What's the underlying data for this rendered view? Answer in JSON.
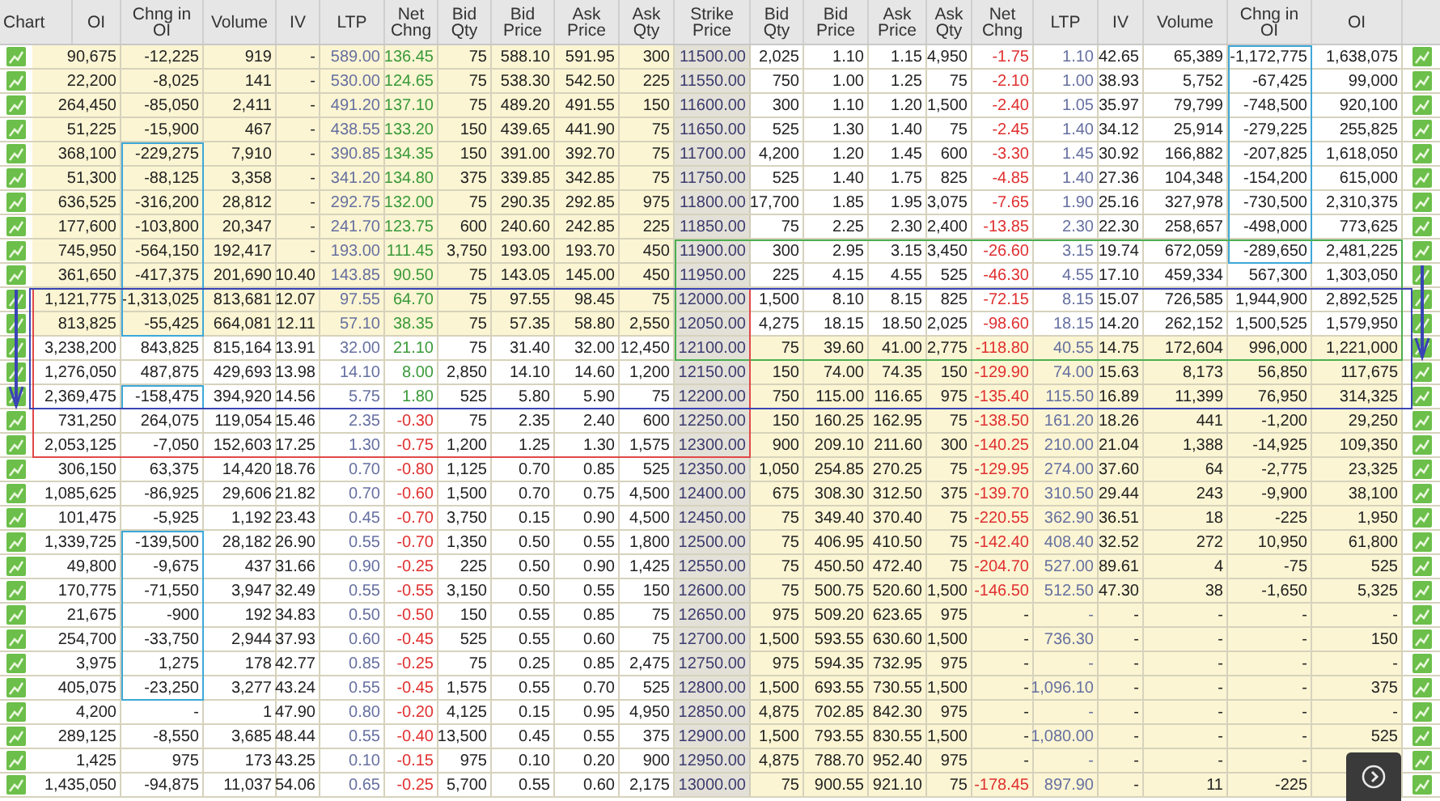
{
  "columns": [
    "Chart",
    "OI",
    "Chng in OI",
    "Volume",
    "IV",
    "LTP",
    "Net Chng",
    "Bid Qty",
    "Bid Price",
    "Ask Price",
    "Ask Qty",
    "Strike Price",
    "Bid Qty",
    "Bid Price",
    "Ask Price",
    "Ask Qty",
    "Net Chng",
    "LTP",
    "IV",
    "Volume",
    "Chng in OI",
    "OI"
  ],
  "rows": [
    {
      "strike": "11500.00",
      "call_itm": true,
      "put_itm": false,
      "call": [
        "90,675",
        "-12,225",
        "919",
        "-",
        "589.00",
        {
          "text": "136.45",
          "color": "#3a9a3a"
        },
        "75",
        "588.10",
        "591.95",
        "300"
      ],
      "put": [
        "2,025",
        "1.10",
        "1.15",
        "4,950",
        {
          "text": "-1.75",
          "color": "#e03030"
        },
        "1.10",
        "42.65",
        "65,389",
        "-1,172,775",
        "1,638,075"
      ]
    },
    {
      "strike": "11550.00",
      "call_itm": true,
      "put_itm": false,
      "call": [
        "22,200",
        "-8,025",
        "141",
        "-",
        "530.00",
        {
          "text": "124.65",
          "color": "#3a9a3a"
        },
        "75",
        "538.30",
        "542.50",
        "225"
      ],
      "put": [
        "750",
        "1.00",
        "1.25",
        "75",
        {
          "text": "-2.10",
          "color": "#e03030"
        },
        "1.00",
        "38.93",
        "5,752",
        "-67,425",
        "99,000"
      ]
    },
    {
      "strike": "11600.00",
      "call_itm": true,
      "put_itm": false,
      "call": [
        "264,450",
        "-85,050",
        "2,411",
        "-",
        "491.20",
        {
          "text": "137.10",
          "color": "#3a9a3a"
        },
        "75",
        "489.20",
        "491.55",
        "150"
      ],
      "put": [
        "300",
        "1.10",
        "1.20",
        "1,500",
        {
          "text": "-2.40",
          "color": "#e03030"
        },
        "1.05",
        "35.97",
        "79,799",
        "-748,500",
        "920,100"
      ]
    },
    {
      "strike": "11650.00",
      "call_itm": true,
      "put_itm": false,
      "call": [
        "51,225",
        "-15,900",
        "467",
        "-",
        "438.55",
        {
          "text": "133.20",
          "color": "#3a9a3a"
        },
        "150",
        "439.65",
        "441.90",
        "75"
      ],
      "put": [
        "525",
        "1.30",
        "1.40",
        "75",
        {
          "text": "-2.45",
          "color": "#e03030"
        },
        "1.40",
        "34.12",
        "25,914",
        "-279,225",
        "255,825"
      ]
    },
    {
      "strike": "11700.00",
      "call_itm": true,
      "put_itm": false,
      "call": [
        "368,100",
        "-229,275",
        "7,910",
        "-",
        "390.85",
        {
          "text": "134.35",
          "color": "#3a9a3a"
        },
        "150",
        "391.00",
        "392.70",
        "75"
      ],
      "put": [
        "4,200",
        "1.20",
        "1.45",
        "600",
        {
          "text": "-3.30",
          "color": "#e03030"
        },
        "1.45",
        "30.92",
        "166,882",
        "-207,825",
        "1,618,050"
      ]
    },
    {
      "strike": "11750.00",
      "call_itm": true,
      "put_itm": false,
      "call": [
        "51,300",
        "-88,125",
        "3,358",
        "-",
        "341.20",
        {
          "text": "134.80",
          "color": "#3a9a3a"
        },
        "375",
        "339.85",
        "342.85",
        "75"
      ],
      "put": [
        "525",
        "1.40",
        "1.75",
        "825",
        {
          "text": "-4.85",
          "color": "#e03030"
        },
        "1.40",
        "27.36",
        "104,348",
        "-154,200",
        "615,000"
      ]
    },
    {
      "strike": "11800.00",
      "call_itm": true,
      "put_itm": false,
      "call": [
        "636,525",
        "-316,200",
        "28,812",
        "-",
        "292.75",
        {
          "text": "132.00",
          "color": "#3a9a3a"
        },
        "75",
        "290.35",
        "292.85",
        "975"
      ],
      "put": [
        "17,700",
        "1.85",
        "1.95",
        "3,075",
        {
          "text": "-7.65",
          "color": "#e03030"
        },
        "1.90",
        "25.16",
        "327,978",
        "-730,500",
        "2,310,375"
      ]
    },
    {
      "strike": "11850.00",
      "call_itm": true,
      "put_itm": false,
      "call": [
        "177,600",
        "-103,800",
        "20,347",
        "-",
        "241.70",
        {
          "text": "123.75",
          "color": "#3a9a3a"
        },
        "600",
        "240.60",
        "242.85",
        "225"
      ],
      "put": [
        "75",
        "2.25",
        "2.30",
        "2,400",
        {
          "text": "-13.85",
          "color": "#e03030"
        },
        "2.30",
        "22.30",
        "258,657",
        "-498,000",
        "773,625"
      ]
    },
    {
      "strike": "11900.00",
      "call_itm": true,
      "put_itm": false,
      "call": [
        "745,950",
        "-564,150",
        "192,417",
        "-",
        "193.00",
        {
          "text": "111.45",
          "color": "#3a9a3a"
        },
        "3,750",
        "193.00",
        "193.70",
        "450"
      ],
      "put": [
        "300",
        "2.95",
        "3.15",
        "3,450",
        {
          "text": "-26.60",
          "color": "#e03030"
        },
        "3.15",
        "19.74",
        "672,059",
        "-289,650",
        "2,481,225"
      ]
    },
    {
      "strike": "11950.00",
      "call_itm": true,
      "put_itm": false,
      "call": [
        "361,650",
        "-417,375",
        "201,690",
        "10.40",
        "143.85",
        {
          "text": "90.50",
          "color": "#3a9a3a"
        },
        "75",
        "143.05",
        "145.00",
        "450"
      ],
      "put": [
        "225",
        "4.15",
        "4.55",
        "525",
        {
          "text": "-46.30",
          "color": "#e03030"
        },
        "4.55",
        "17.10",
        "459,334",
        "567,300",
        "1,303,050"
      ]
    },
    {
      "strike": "12000.00",
      "call_itm": true,
      "put_itm": false,
      "call": [
        "1,121,775",
        "-1,313,025",
        "813,681",
        "12.07",
        "97.55",
        {
          "text": "64.70",
          "color": "#3a9a3a"
        },
        "75",
        "97.55",
        "98.45",
        "75"
      ],
      "put": [
        "1,500",
        "8.10",
        "8.15",
        "825",
        {
          "text": "-72.15",
          "color": "#e03030"
        },
        "8.15",
        "15.07",
        "726,585",
        "1,944,900",
        "2,892,525"
      ]
    },
    {
      "strike": "12050.00",
      "call_itm": true,
      "put_itm": false,
      "call": [
        "813,825",
        "-55,425",
        "664,081",
        "12.11",
        "57.10",
        {
          "text": "38.35",
          "color": "#3a9a3a"
        },
        "75",
        "57.35",
        "58.80",
        "2,550"
      ],
      "put": [
        "4,275",
        "18.15",
        "18.50",
        "2,025",
        {
          "text": "-98.60",
          "color": "#e03030"
        },
        "18.15",
        "14.20",
        "262,152",
        "1,500,525",
        "1,579,950"
      ]
    },
    {
      "strike": "12100.00",
      "call_itm": false,
      "put_itm": true,
      "call": [
        "3,238,200",
        "843,825",
        "815,164",
        "13.91",
        "32.00",
        {
          "text": "21.10",
          "color": "#3a9a3a"
        },
        "75",
        "31.40",
        "32.00",
        "12,450"
      ],
      "put": [
        "75",
        "39.60",
        "41.00",
        "2,775",
        {
          "text": "-118.80",
          "color": "#e03030"
        },
        "40.55",
        "14.75",
        "172,604",
        "996,000",
        "1,221,000"
      ]
    },
    {
      "strike": "12150.00",
      "call_itm": false,
      "put_itm": true,
      "call": [
        "1,276,050",
        "487,875",
        "429,693",
        "13.98",
        "14.10",
        {
          "text": "8.00",
          "color": "#3a9a3a"
        },
        "2,850",
        "14.10",
        "14.60",
        "1,200"
      ],
      "put": [
        "150",
        "74.00",
        "74.35",
        "150",
        {
          "text": "-129.90",
          "color": "#e03030"
        },
        "74.00",
        "15.63",
        "8,173",
        "56,850",
        "117,675"
      ]
    },
    {
      "strike": "12200.00",
      "call_itm": false,
      "put_itm": true,
      "call": [
        "2,369,475",
        "-158,475",
        "394,920",
        "14.56",
        "5.75",
        {
          "text": "1.80",
          "color": "#3a9a3a"
        },
        "525",
        "5.80",
        "5.90",
        "75"
      ],
      "put": [
        "750",
        "115.00",
        "116.65",
        "975",
        {
          "text": "-135.40",
          "color": "#e03030"
        },
        "115.50",
        "16.89",
        "11,399",
        "76,950",
        "314,325"
      ]
    },
    {
      "strike": "12250.00",
      "call_itm": false,
      "put_itm": true,
      "call": [
        "731,250",
        "264,075",
        "119,054",
        "15.46",
        "2.35",
        {
          "text": "-0.30",
          "color": "#e03030"
        },
        "75",
        "2.35",
        "2.40",
        "600"
      ],
      "put": [
        "150",
        "160.25",
        "162.95",
        "75",
        {
          "text": "-138.50",
          "color": "#e03030"
        },
        "161.20",
        "18.26",
        "441",
        "-1,200",
        "29,250"
      ]
    },
    {
      "strike": "12300.00",
      "call_itm": false,
      "put_itm": true,
      "call": [
        "2,053,125",
        "-7,050",
        "152,603",
        "17.25",
        "1.30",
        {
          "text": "-0.75",
          "color": "#e03030"
        },
        "1,200",
        "1.25",
        "1.30",
        "1,575"
      ],
      "put": [
        "900",
        "209.10",
        "211.60",
        "300",
        {
          "text": "-140.25",
          "color": "#e03030"
        },
        "210.00",
        "21.04",
        "1,388",
        "-14,925",
        "109,350"
      ]
    },
    {
      "strike": "12350.00",
      "call_itm": false,
      "put_itm": true,
      "call": [
        "306,150",
        "63,375",
        "14,420",
        "18.76",
        "0.70",
        {
          "text": "-0.80",
          "color": "#e03030"
        },
        "1,125",
        "0.70",
        "0.85",
        "525"
      ],
      "put": [
        "1,050",
        "254.85",
        "270.25",
        "75",
        {
          "text": "-129.95",
          "color": "#e03030"
        },
        "274.00",
        "37.60",
        "64",
        "-2,775",
        "23,325"
      ]
    },
    {
      "strike": "12400.00",
      "call_itm": false,
      "put_itm": true,
      "call": [
        "1,085,625",
        "-86,925",
        "29,606",
        "21.82",
        "0.70",
        {
          "text": "-0.60",
          "color": "#e03030"
        },
        "1,500",
        "0.70",
        "0.75",
        "4,500"
      ],
      "put": [
        "675",
        "308.30",
        "312.50",
        "375",
        {
          "text": "-139.70",
          "color": "#e03030"
        },
        "310.50",
        "29.44",
        "243",
        "-9,900",
        "38,100"
      ]
    },
    {
      "strike": "12450.00",
      "call_itm": false,
      "put_itm": true,
      "call": [
        "101,475",
        "-5,925",
        "1,192",
        "23.43",
        "0.45",
        {
          "text": "-0.70",
          "color": "#e03030"
        },
        "3,750",
        "0.15",
        "0.90",
        "4,500"
      ],
      "put": [
        "75",
        "349.40",
        "370.40",
        "75",
        {
          "text": "-220.55",
          "color": "#e03030"
        },
        "362.90",
        "36.51",
        "18",
        "-225",
        "1,950"
      ]
    },
    {
      "strike": "12500.00",
      "call_itm": false,
      "put_itm": true,
      "call": [
        "1,339,725",
        "-139,500",
        "28,182",
        "26.90",
        "0.55",
        {
          "text": "-0.70",
          "color": "#e03030"
        },
        "1,350",
        "0.50",
        "0.55",
        "1,800"
      ],
      "put": [
        "75",
        "406.95",
        "410.50",
        "75",
        {
          "text": "-142.40",
          "color": "#e03030"
        },
        "408.40",
        "32.52",
        "272",
        "10,950",
        "61,800"
      ]
    },
    {
      "strike": "12550.00",
      "call_itm": false,
      "put_itm": true,
      "call": [
        "49,800",
        "-9,675",
        "437",
        "31.66",
        "0.90",
        {
          "text": "-0.25",
          "color": "#e03030"
        },
        "225",
        "0.50",
        "0.90",
        "1,425"
      ],
      "put": [
        "75",
        "450.50",
        "472.40",
        "75",
        {
          "text": "-204.70",
          "color": "#e03030"
        },
        "527.00",
        "89.61",
        "4",
        "-75",
        "525"
      ]
    },
    {
      "strike": "12600.00",
      "call_itm": false,
      "put_itm": true,
      "call": [
        "170,775",
        "-71,550",
        "3,947",
        "32.49",
        "0.55",
        {
          "text": "-0.55",
          "color": "#e03030"
        },
        "3,150",
        "0.50",
        "0.55",
        "150"
      ],
      "put": [
        "75",
        "500.75",
        "520.60",
        "1,500",
        {
          "text": "-146.50",
          "color": "#e03030"
        },
        "512.50",
        "47.30",
        "38",
        "-1,650",
        "5,325"
      ]
    },
    {
      "strike": "12650.00",
      "call_itm": false,
      "put_itm": true,
      "call": [
        "21,675",
        "-900",
        "192",
        "34.83",
        "0.50",
        {
          "text": "-0.50",
          "color": "#e03030"
        },
        "150",
        "0.55",
        "0.85",
        "75"
      ],
      "put": [
        "975",
        "509.20",
        "623.65",
        "975",
        "-",
        "-",
        "-",
        "-",
        "-",
        "-"
      ]
    },
    {
      "strike": "12700.00",
      "call_itm": false,
      "put_itm": true,
      "call": [
        "254,700",
        "-33,750",
        "2,944",
        "37.93",
        "0.60",
        {
          "text": "-0.45",
          "color": "#e03030"
        },
        "525",
        "0.55",
        "0.60",
        "75"
      ],
      "put": [
        "1,500",
        "593.55",
        "630.60",
        "1,500",
        "-",
        "736.30",
        "-",
        "-",
        "-",
        "150"
      ]
    },
    {
      "strike": "12750.00",
      "call_itm": false,
      "put_itm": true,
      "call": [
        "3,975",
        "1,275",
        "178",
        "42.77",
        "0.85",
        {
          "text": "-0.25",
          "color": "#e03030"
        },
        "75",
        "0.25",
        "0.85",
        "2,475"
      ],
      "put": [
        "975",
        "594.35",
        "732.95",
        "975",
        "-",
        "-",
        "-",
        "-",
        "-",
        "-"
      ]
    },
    {
      "strike": "12800.00",
      "call_itm": false,
      "put_itm": true,
      "call": [
        "405,075",
        "-23,250",
        "3,277",
        "43.24",
        "0.55",
        {
          "text": "-0.45",
          "color": "#e03030"
        },
        "1,575",
        "0.55",
        "0.70",
        "525"
      ],
      "put": [
        "1,500",
        "693.55",
        "730.55",
        "1,500",
        "-",
        "1,096.10",
        "-",
        "-",
        "-",
        "375"
      ]
    },
    {
      "strike": "12850.00",
      "call_itm": false,
      "put_itm": true,
      "call": [
        "4,200",
        "-",
        "1",
        "47.90",
        "0.80",
        {
          "text": "-0.20",
          "color": "#e03030"
        },
        "4,125",
        "0.15",
        "0.95",
        "4,950"
      ],
      "put": [
        "4,875",
        "702.85",
        "842.30",
        "975",
        "-",
        "-",
        "-",
        "-",
        "-",
        "-"
      ]
    },
    {
      "strike": "12900.00",
      "call_itm": false,
      "put_itm": true,
      "call": [
        "289,125",
        "-8,550",
        "3,685",
        "48.44",
        "0.55",
        {
          "text": "-0.40",
          "color": "#e03030"
        },
        "13,500",
        "0.45",
        "0.55",
        "375"
      ],
      "put": [
        "1,500",
        "793.55",
        "830.55",
        "1,500",
        "-",
        "1,080.00",
        "-",
        "-",
        "-",
        "525"
      ]
    },
    {
      "strike": "12950.00",
      "call_itm": false,
      "put_itm": true,
      "call": [
        "1,425",
        "975",
        "173",
        "43.25",
        "0.10",
        {
          "text": "-0.15",
          "color": "#e03030"
        },
        "975",
        "0.10",
        "0.20",
        "900"
      ],
      "put": [
        "4,875",
        "788.70",
        "952.40",
        "975",
        "-",
        "-",
        "-",
        "-",
        "-"
      ]
    },
    {
      "strike": "13000.00",
      "call_itm": false,
      "put_itm": true,
      "call": [
        "1,435,050",
        "-94,875",
        "11,037",
        "54.06",
        "0.65",
        {
          "text": "-0.25",
          "color": "#e03030"
        },
        "5,700",
        "0.55",
        "0.60",
        "2,175"
      ],
      "put": [
        "75",
        "900.55",
        "921.10",
        "75",
        {
          "text": "-178.45",
          "color": "#e03030"
        },
        "897.90",
        "-",
        "11",
        "-225"
      ]
    }
  ]
}
